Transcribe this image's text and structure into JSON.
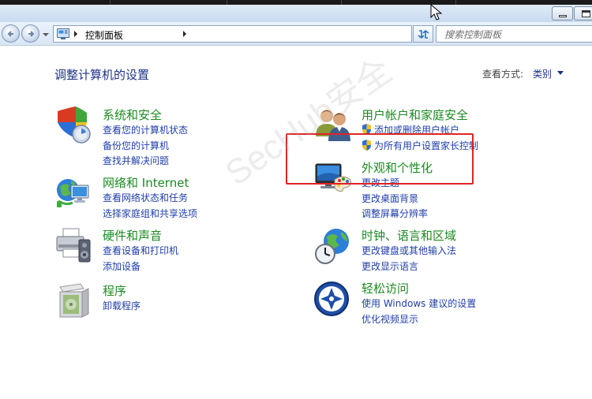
{
  "address": {
    "breadcrumb": "控制面板",
    "search_placeholder": "搜索控制面板"
  },
  "page": {
    "heading": "调整计算机的设置",
    "view_by_label": "查看方式:",
    "view_by_value": "类别"
  },
  "watermark": "SecHub安全",
  "categories_left": [
    {
      "title": "系统和安全",
      "icon": "system-security-shield-icon",
      "links": [
        "查看您的计算机状态",
        "备份您的计算机",
        "查找并解决问题"
      ]
    },
    {
      "title": "网络和 Internet",
      "icon": "network-globe-icon",
      "links": [
        "查看网络状态和任务",
        "选择家庭组和共享选项"
      ]
    },
    {
      "title": "硬件和声音",
      "icon": "printer-speaker-icon",
      "links": [
        "查看设备和打印机",
        "添加设备"
      ]
    },
    {
      "title": "程序",
      "icon": "programs-box-icon",
      "links": [
        "卸载程序"
      ]
    }
  ],
  "categories_right": [
    {
      "title": "用户帐户和家庭安全",
      "icon": "users-icon",
      "links": [
        "添加或删除用户帐户",
        "为所有用户设置家长控制"
      ]
    },
    {
      "title": "外观和个性化",
      "icon": "monitor-palette-icon",
      "links": [
        "更改主题",
        "更改桌面背景",
        "调整屏幕分辨率"
      ]
    },
    {
      "title": "时钟、语言和区域",
      "icon": "clock-globe-icon",
      "links": [
        "更改键盘或其他输入法",
        "更改显示语言"
      ]
    },
    {
      "title": "轻松访问",
      "icon": "ease-of-access-icon",
      "links": [
        "使用 Windows 建议的设置",
        "优化视频显示"
      ]
    }
  ],
  "colors": {
    "category_title": "#1a8a20",
    "link": "#1f3ea8",
    "heading": "#1e3287",
    "highlight_box": "#e02424"
  }
}
